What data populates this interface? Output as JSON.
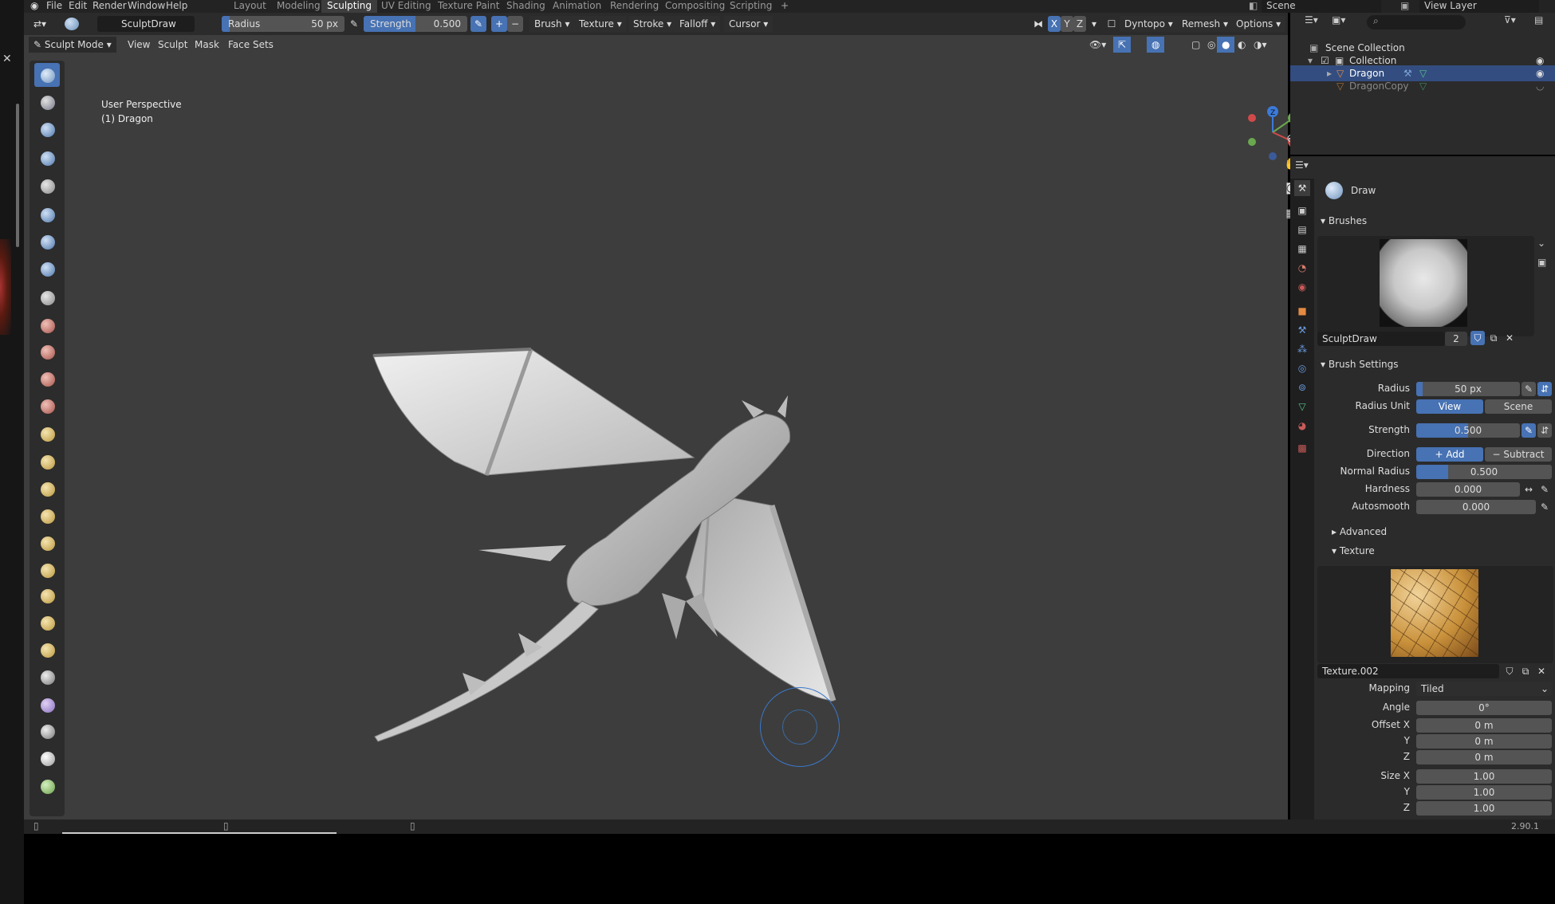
{
  "menu": [
    "File",
    "Edit",
    "Render",
    "Window",
    "Help"
  ],
  "workspaces": [
    {
      "label": "Layout",
      "active": false
    },
    {
      "label": "Modeling",
      "active": false
    },
    {
      "label": "Sculpting",
      "active": true
    },
    {
      "label": "UV Editing",
      "active": false
    },
    {
      "label": "Texture Paint",
      "active": false
    },
    {
      "label": "Shading",
      "active": false
    },
    {
      "label": "Animation",
      "active": false
    },
    {
      "label": "Rendering",
      "active": false
    },
    {
      "label": "Compositing",
      "active": false
    },
    {
      "label": "Scripting",
      "active": false
    }
  ],
  "scene": "Scene",
  "view_layer": "View Layer",
  "tool_header": {
    "brush_name": "SculptDraw",
    "radius_label": "Radius",
    "radius_value": "50 px",
    "strength_label": "Strength",
    "strength_value": "0.500",
    "menus": [
      "Brush",
      "Texture",
      "Stroke",
      "Falloff",
      "Cursor"
    ],
    "axes": [
      "X",
      "Y",
      "Z"
    ],
    "dyntopo": "Dyntopo",
    "remesh": "Remesh",
    "options": "Options"
  },
  "mode_header": {
    "mode": "Sculpt Mode",
    "menus": [
      "View",
      "Sculpt",
      "Mask",
      "Face Sets"
    ]
  },
  "viewport": {
    "perspective": "User Perspective",
    "object": "(1) Dragon"
  },
  "outliner": {
    "scene_collection": "Scene Collection",
    "collection": "Collection",
    "objects": [
      "Dragon",
      "DragonCopy"
    ]
  },
  "props": {
    "tool_name": "Draw",
    "brushes_header": "Brushes",
    "brush_name": "SculptDraw",
    "brush_users": "2",
    "brush_settings_header": "Brush Settings",
    "radius_label": "Radius",
    "radius_value": "50 px",
    "radius_unit_label": "Radius Unit",
    "radius_unit_view": "View",
    "radius_unit_scene": "Scene",
    "strength_label": "Strength",
    "strength_value": "0.500",
    "strength_fraction": 0.5,
    "direction_label": "Direction",
    "direction_add": "Add",
    "direction_subtract": "Subtract",
    "normal_radius_label": "Normal Radius",
    "normal_radius_value": "0.500",
    "hardness_label": "Hardness",
    "hardness_value": "0.000",
    "autosmooth_label": "Autosmooth",
    "autosmooth_value": "0.000",
    "advanced_header": "Advanced",
    "texture_header": "Texture",
    "texture_name": "Texture.002",
    "mapping_label": "Mapping",
    "mapping_value": "Tiled",
    "angle_label": "Angle",
    "angle_value": "0°",
    "offset_x_label": "Offset X",
    "offset_x": "0 m",
    "offset_y_label": "Y",
    "offset_y": "0 m",
    "offset_z_label": "Z",
    "offset_z": "0 m",
    "size_x_label": "Size X",
    "size_x": "1.00",
    "size_y_label": "Y",
    "size_y": "1.00",
    "size_z_label": "Z",
    "size_z": "1.00"
  },
  "version": "2.90.1"
}
